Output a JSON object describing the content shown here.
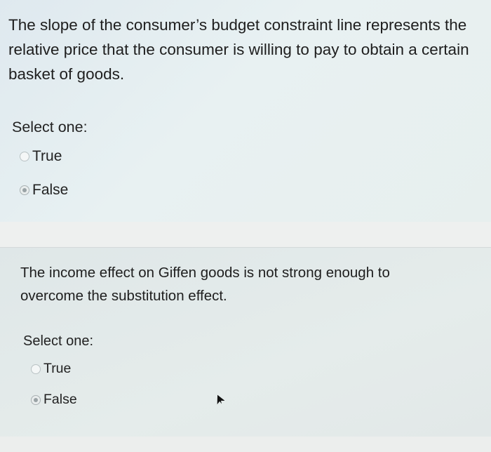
{
  "questions": [
    {
      "text": "The slope of the consumer’s budget constraint line represents the relative price that the consumer is willing to pay to obtain a certain basket of goods.",
      "select_label": "Select one:",
      "options": [
        {
          "label": "True",
          "selected": false
        },
        {
          "label": "False",
          "selected": true
        }
      ]
    },
    {
      "text": "The income effect on Giffen goods is not strong enough to overcome the substitution effect.",
      "select_label": "Select one:",
      "options": [
        {
          "label": "True",
          "selected": false
        },
        {
          "label": "False",
          "selected": true
        }
      ]
    }
  ],
  "icons": {
    "radio_unselected": "radio-unselected-icon",
    "radio_selected": "radio-selected-icon",
    "pointer": "mouse-pointer-icon"
  }
}
